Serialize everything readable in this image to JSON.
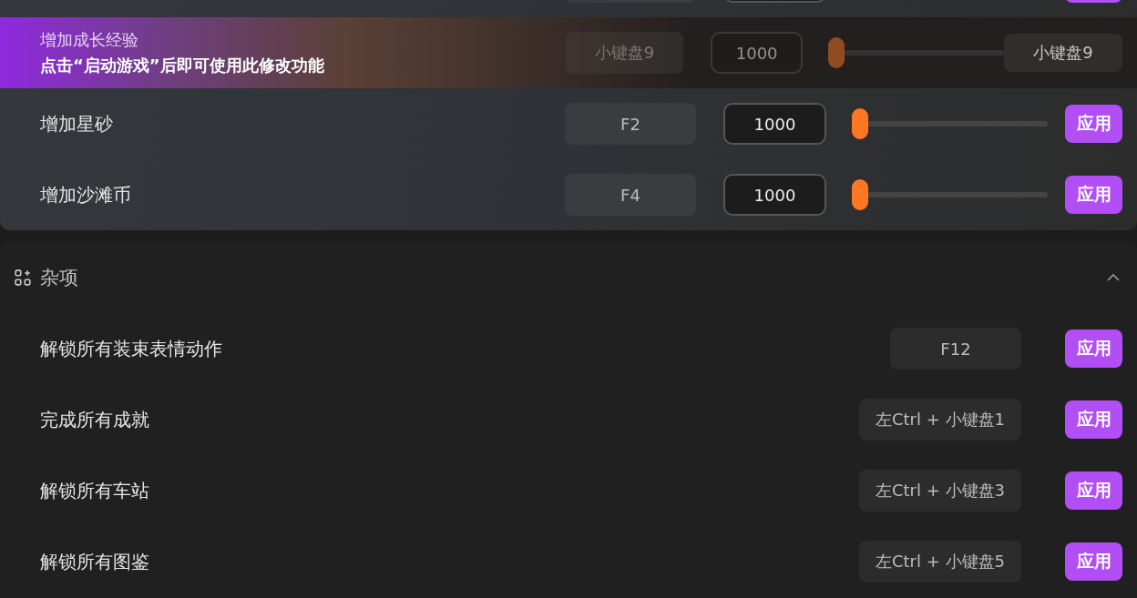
{
  "top_panel": {
    "rows": [
      {
        "kind": "clipped"
      },
      {
        "kind": "tooltip",
        "tooltip_title": "增加成长经验",
        "tooltip_text": "点击“启动游戏”后即可使用此修改功能",
        "hotkey": "小键盘9",
        "value": "1000",
        "level": 0,
        "button": "小键盘9"
      },
      {
        "kind": "slider",
        "label": "增加星砂",
        "hotkey": "F2",
        "value": "1000",
        "level": 0,
        "button": "应用"
      },
      {
        "kind": "slider",
        "label": "增加沙滩币",
        "hotkey": "F4",
        "value": "1000",
        "level": 0,
        "button": "应用"
      }
    ]
  },
  "misc_section": {
    "title": "杂项",
    "expanded": true,
    "rows": [
      {
        "label": "解锁所有装束表情动作",
        "hotkey": "F12",
        "button": "应用"
      },
      {
        "label": "完成所有成就",
        "hotkey": "左Ctrl + 小键盘1",
        "button": "应用"
      },
      {
        "label": "解锁所有车站",
        "hotkey": "左Ctrl + 小键盘3",
        "button": "应用"
      },
      {
        "label": "解锁所有图鉴",
        "hotkey": "左Ctrl + 小键盘5",
        "button": "应用"
      }
    ]
  }
}
